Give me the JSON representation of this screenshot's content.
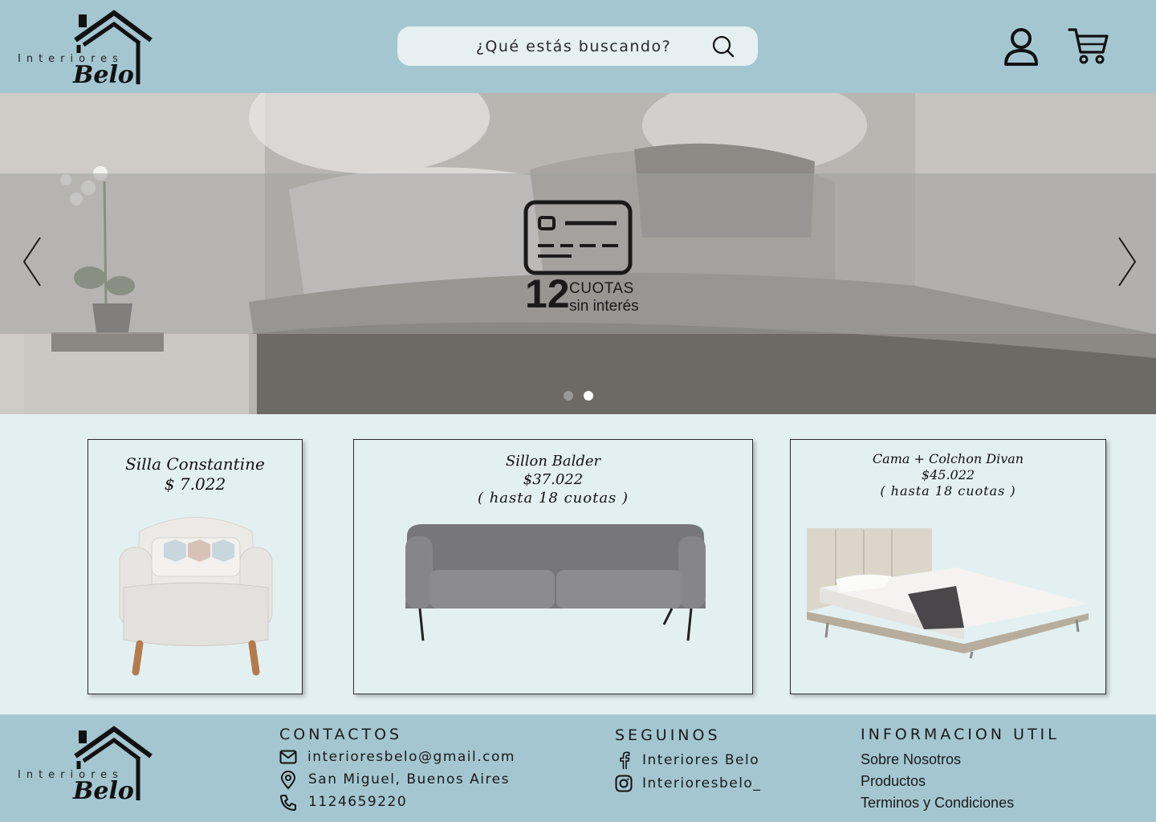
{
  "brand": {
    "prefix": "Interiores",
    "name": "Belo"
  },
  "header": {
    "search_placeholder": "¿Qué estás buscando?",
    "icons": [
      "search-icon",
      "user-icon",
      "cart-icon"
    ]
  },
  "hero": {
    "promo_number": "12",
    "promo_line1": "CUOTAS",
    "promo_line2": "sin interés",
    "slide_count": 2,
    "active_slide": 2
  },
  "products": [
    {
      "name": "Silla Constantine",
      "price": "$ 7.022",
      "note": ""
    },
    {
      "name": "Sillon Balder",
      "price": "$37.022",
      "note": "( hasta 18 cuotas )"
    },
    {
      "name": "Cama + Colchon Divan",
      "price": "$45.022",
      "note": "( hasta 18 cuotas )"
    }
  ],
  "footer": {
    "contactos": {
      "title": "CONTACTOS",
      "email": "interioresbelo@gmail.com",
      "address": "San Miguel, Buenos Aires",
      "phone": "1124659220"
    },
    "seguinos": {
      "title": "SEGUINOS",
      "facebook": "Interiores Belo",
      "instagram": "Interioresbelo_"
    },
    "info": {
      "title": "INFORMACION UTIL",
      "links": [
        "Sobre Nosotros",
        "Productos",
        "Terminos y Condiciones"
      ]
    }
  },
  "colors": {
    "header_bg": "#a4c6d0",
    "page_bg": "#e3f0f1",
    "search_bg": "#e6eff2",
    "dot_active": "#ffffff",
    "dot_inactive": "#9a9896"
  }
}
